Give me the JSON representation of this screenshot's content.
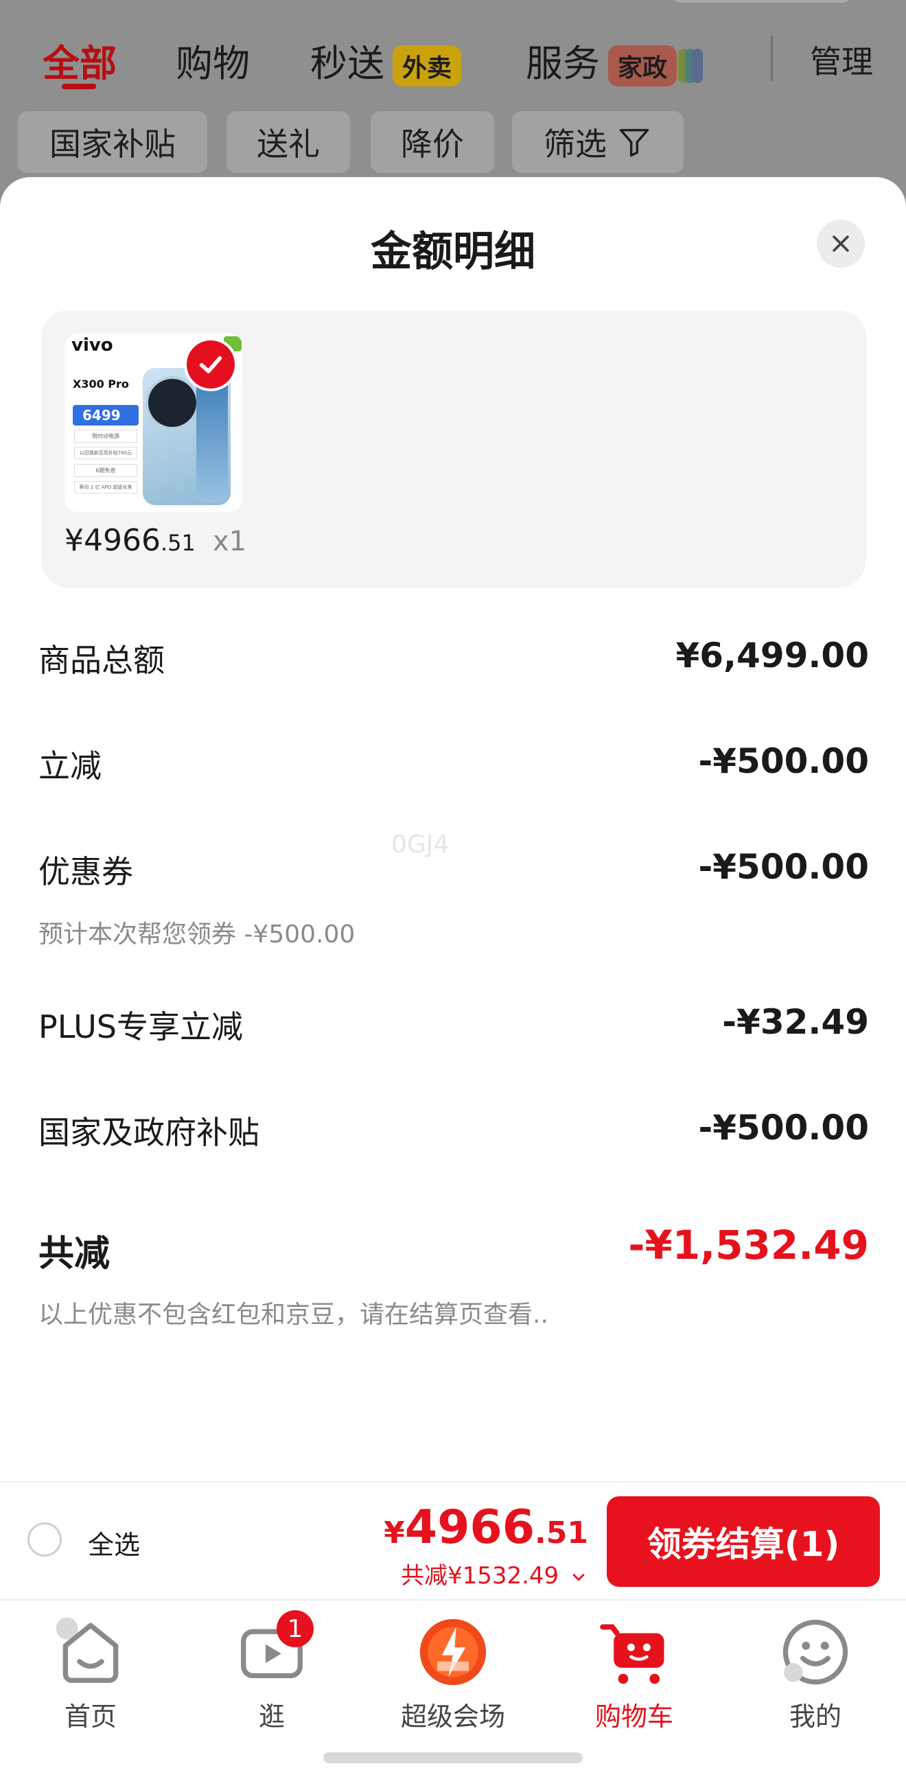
{
  "top_tabs": {
    "all": "全部",
    "shopping": "购物",
    "express": "秒送",
    "express_badge": "外卖",
    "service": "服务",
    "service_badge": "家政",
    "manage": "管理"
  },
  "filters": [
    "国家补贴",
    "送礼",
    "降价",
    "筛选"
  ],
  "sheet": {
    "title": "金额明细",
    "product": {
      "brand": "vivo",
      "model": "X300 Pro",
      "thumb_price": "6499",
      "thumb_lines": [
        "限时动电源",
        "以旧换新至高补贴780元",
        "6期免息",
        "蔡司 2 亿 APO 超级长焦"
      ],
      "price_main": "¥4966",
      "price_decimal": ".51",
      "quantity": "x1"
    },
    "rows": [
      {
        "label": "商品总额",
        "value": "¥6,499.00"
      },
      {
        "label": "立减",
        "value": "-¥500.00"
      },
      {
        "label": "优惠券",
        "value": "-¥500.00",
        "note": "预计本次帮您领券 -¥500.00"
      },
      {
        "label": "PLUS专享立减",
        "value": "-¥32.49"
      },
      {
        "label": "国家及政府补贴",
        "value": "-¥500.00"
      }
    ],
    "total": {
      "label": "共减",
      "value": "-¥1,532.49",
      "note": "以上优惠不包含红包和京豆，请在结算页查看.."
    },
    "watermark": "0GJ4"
  },
  "checkout": {
    "select_all": "全选",
    "currency": "¥",
    "price_int": "4966",
    "price_dec": ".51",
    "saved": "共减¥1532.49",
    "button": "领券结算(1)"
  },
  "nav": {
    "items": [
      {
        "label": "首页",
        "icon": "home-icon"
      },
      {
        "label": "逛",
        "icon": "video-icon",
        "badge": "1"
      },
      {
        "label": "超级会场",
        "icon": "super-venue-icon"
      },
      {
        "label": "购物车",
        "icon": "cart-icon",
        "active": true
      },
      {
        "label": "我的",
        "icon": "smile-icon"
      }
    ]
  },
  "colors": {
    "accent": "#e5121e",
    "overlay": "#8f8f8f",
    "card_bg": "#f4f4f6"
  }
}
